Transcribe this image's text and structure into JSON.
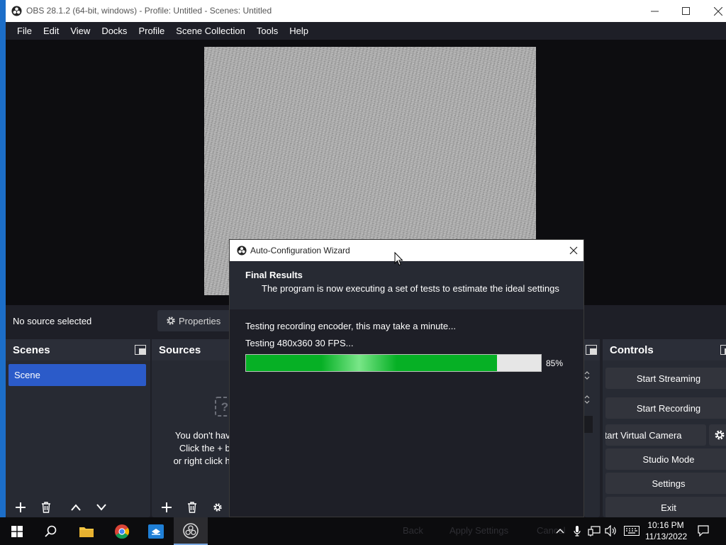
{
  "window": {
    "title": "OBS 28.1.2 (64-bit, windows) - Profile: Untitled - Scenes: Untitled"
  },
  "menu": [
    "File",
    "Edit",
    "View",
    "Docks",
    "Profile",
    "Scene Collection",
    "Tools",
    "Help"
  ],
  "source_toolbar": {
    "no_source": "No source selected",
    "properties": "Properties"
  },
  "scenes": {
    "title": "Scenes",
    "items": [
      "Scene"
    ]
  },
  "sources": {
    "title": "Sources",
    "empty_lines": [
      "You don't have",
      "Click the + bu",
      "or right click he"
    ]
  },
  "controls": {
    "title": "Controls",
    "start_streaming": "Start Streaming",
    "start_recording": "Start Recording",
    "start_virtual_camera": "Start Virtual Camera",
    "studio_mode": "Studio Mode",
    "settings": "Settings",
    "exit": "Exit"
  },
  "dialog": {
    "title": "Auto-Configuration Wizard",
    "heading": "Final Results",
    "subheading": "The program is now executing a set of tests to estimate the ideal settings",
    "status_line_1": "Testing recording encoder, this may take a minute...",
    "status_line_2": "Testing 480x360 30 FPS...",
    "progress": 85,
    "progress_label": "85%",
    "buttons_behind": [
      "Back",
      "Apply Settings",
      "Cancel"
    ]
  },
  "taskbar": {
    "time": "10:16 PM",
    "date": "11/13/2022"
  },
  "colors": {
    "accent_selected": "#2b5bc9",
    "panel_bg": "#272a33",
    "window_bg": "#1e1f27",
    "progress_green": "#06b025"
  }
}
